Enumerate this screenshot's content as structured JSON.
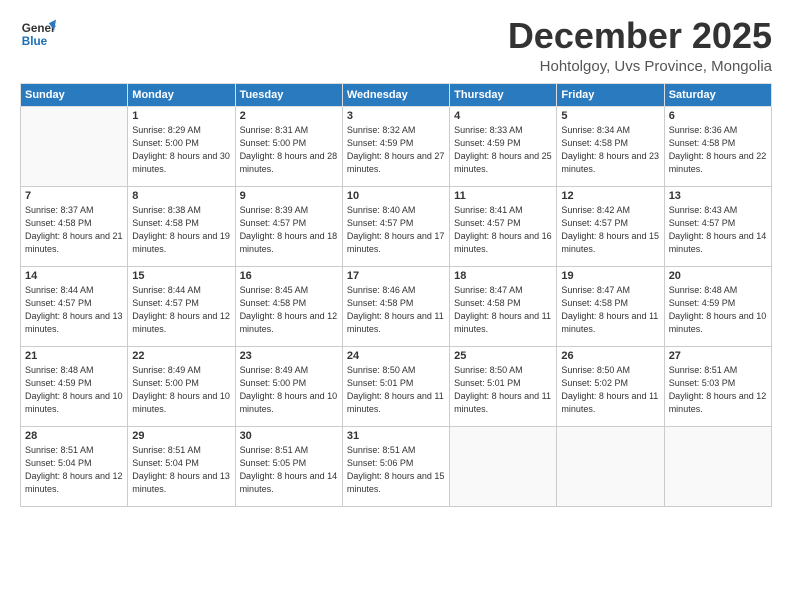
{
  "logo": {
    "line1": "General",
    "line2": "Blue"
  },
  "title": "December 2025",
  "location": "Hohtolgoy, Uvs Province, Mongolia",
  "days_header": [
    "Sunday",
    "Monday",
    "Tuesday",
    "Wednesday",
    "Thursday",
    "Friday",
    "Saturday"
  ],
  "weeks": [
    [
      {
        "num": "",
        "sunrise": "",
        "sunset": "",
        "daylight": ""
      },
      {
        "num": "1",
        "sunrise": "Sunrise: 8:29 AM",
        "sunset": "Sunset: 5:00 PM",
        "daylight": "Daylight: 8 hours and 30 minutes."
      },
      {
        "num": "2",
        "sunrise": "Sunrise: 8:31 AM",
        "sunset": "Sunset: 5:00 PM",
        "daylight": "Daylight: 8 hours and 28 minutes."
      },
      {
        "num": "3",
        "sunrise": "Sunrise: 8:32 AM",
        "sunset": "Sunset: 4:59 PM",
        "daylight": "Daylight: 8 hours and 27 minutes."
      },
      {
        "num": "4",
        "sunrise": "Sunrise: 8:33 AM",
        "sunset": "Sunset: 4:59 PM",
        "daylight": "Daylight: 8 hours and 25 minutes."
      },
      {
        "num": "5",
        "sunrise": "Sunrise: 8:34 AM",
        "sunset": "Sunset: 4:58 PM",
        "daylight": "Daylight: 8 hours and 23 minutes."
      },
      {
        "num": "6",
        "sunrise": "Sunrise: 8:36 AM",
        "sunset": "Sunset: 4:58 PM",
        "daylight": "Daylight: 8 hours and 22 minutes."
      }
    ],
    [
      {
        "num": "7",
        "sunrise": "Sunrise: 8:37 AM",
        "sunset": "Sunset: 4:58 PM",
        "daylight": "Daylight: 8 hours and 21 minutes."
      },
      {
        "num": "8",
        "sunrise": "Sunrise: 8:38 AM",
        "sunset": "Sunset: 4:58 PM",
        "daylight": "Daylight: 8 hours and 19 minutes."
      },
      {
        "num": "9",
        "sunrise": "Sunrise: 8:39 AM",
        "sunset": "Sunset: 4:57 PM",
        "daylight": "Daylight: 8 hours and 18 minutes."
      },
      {
        "num": "10",
        "sunrise": "Sunrise: 8:40 AM",
        "sunset": "Sunset: 4:57 PM",
        "daylight": "Daylight: 8 hours and 17 minutes."
      },
      {
        "num": "11",
        "sunrise": "Sunrise: 8:41 AM",
        "sunset": "Sunset: 4:57 PM",
        "daylight": "Daylight: 8 hours and 16 minutes."
      },
      {
        "num": "12",
        "sunrise": "Sunrise: 8:42 AM",
        "sunset": "Sunset: 4:57 PM",
        "daylight": "Daylight: 8 hours and 15 minutes."
      },
      {
        "num": "13",
        "sunrise": "Sunrise: 8:43 AM",
        "sunset": "Sunset: 4:57 PM",
        "daylight": "Daylight: 8 hours and 14 minutes."
      }
    ],
    [
      {
        "num": "14",
        "sunrise": "Sunrise: 8:44 AM",
        "sunset": "Sunset: 4:57 PM",
        "daylight": "Daylight: 8 hours and 13 minutes."
      },
      {
        "num": "15",
        "sunrise": "Sunrise: 8:44 AM",
        "sunset": "Sunset: 4:57 PM",
        "daylight": "Daylight: 8 hours and 12 minutes."
      },
      {
        "num": "16",
        "sunrise": "Sunrise: 8:45 AM",
        "sunset": "Sunset: 4:58 PM",
        "daylight": "Daylight: 8 hours and 12 minutes."
      },
      {
        "num": "17",
        "sunrise": "Sunrise: 8:46 AM",
        "sunset": "Sunset: 4:58 PM",
        "daylight": "Daylight: 8 hours and 11 minutes."
      },
      {
        "num": "18",
        "sunrise": "Sunrise: 8:47 AM",
        "sunset": "Sunset: 4:58 PM",
        "daylight": "Daylight: 8 hours and 11 minutes."
      },
      {
        "num": "19",
        "sunrise": "Sunrise: 8:47 AM",
        "sunset": "Sunset: 4:58 PM",
        "daylight": "Daylight: 8 hours and 11 minutes."
      },
      {
        "num": "20",
        "sunrise": "Sunrise: 8:48 AM",
        "sunset": "Sunset: 4:59 PM",
        "daylight": "Daylight: 8 hours and 10 minutes."
      }
    ],
    [
      {
        "num": "21",
        "sunrise": "Sunrise: 8:48 AM",
        "sunset": "Sunset: 4:59 PM",
        "daylight": "Daylight: 8 hours and 10 minutes."
      },
      {
        "num": "22",
        "sunrise": "Sunrise: 8:49 AM",
        "sunset": "Sunset: 5:00 PM",
        "daylight": "Daylight: 8 hours and 10 minutes."
      },
      {
        "num": "23",
        "sunrise": "Sunrise: 8:49 AM",
        "sunset": "Sunset: 5:00 PM",
        "daylight": "Daylight: 8 hours and 10 minutes."
      },
      {
        "num": "24",
        "sunrise": "Sunrise: 8:50 AM",
        "sunset": "Sunset: 5:01 PM",
        "daylight": "Daylight: 8 hours and 11 minutes."
      },
      {
        "num": "25",
        "sunrise": "Sunrise: 8:50 AM",
        "sunset": "Sunset: 5:01 PM",
        "daylight": "Daylight: 8 hours and 11 minutes."
      },
      {
        "num": "26",
        "sunrise": "Sunrise: 8:50 AM",
        "sunset": "Sunset: 5:02 PM",
        "daylight": "Daylight: 8 hours and 11 minutes."
      },
      {
        "num": "27",
        "sunrise": "Sunrise: 8:51 AM",
        "sunset": "Sunset: 5:03 PM",
        "daylight": "Daylight: 8 hours and 12 minutes."
      }
    ],
    [
      {
        "num": "28",
        "sunrise": "Sunrise: 8:51 AM",
        "sunset": "Sunset: 5:04 PM",
        "daylight": "Daylight: 8 hours and 12 minutes."
      },
      {
        "num": "29",
        "sunrise": "Sunrise: 8:51 AM",
        "sunset": "Sunset: 5:04 PM",
        "daylight": "Daylight: 8 hours and 13 minutes."
      },
      {
        "num": "30",
        "sunrise": "Sunrise: 8:51 AM",
        "sunset": "Sunset: 5:05 PM",
        "daylight": "Daylight: 8 hours and 14 minutes."
      },
      {
        "num": "31",
        "sunrise": "Sunrise: 8:51 AM",
        "sunset": "Sunset: 5:06 PM",
        "daylight": "Daylight: 8 hours and 15 minutes."
      },
      {
        "num": "",
        "sunrise": "",
        "sunset": "",
        "daylight": ""
      },
      {
        "num": "",
        "sunrise": "",
        "sunset": "",
        "daylight": ""
      },
      {
        "num": "",
        "sunrise": "",
        "sunset": "",
        "daylight": ""
      }
    ]
  ]
}
